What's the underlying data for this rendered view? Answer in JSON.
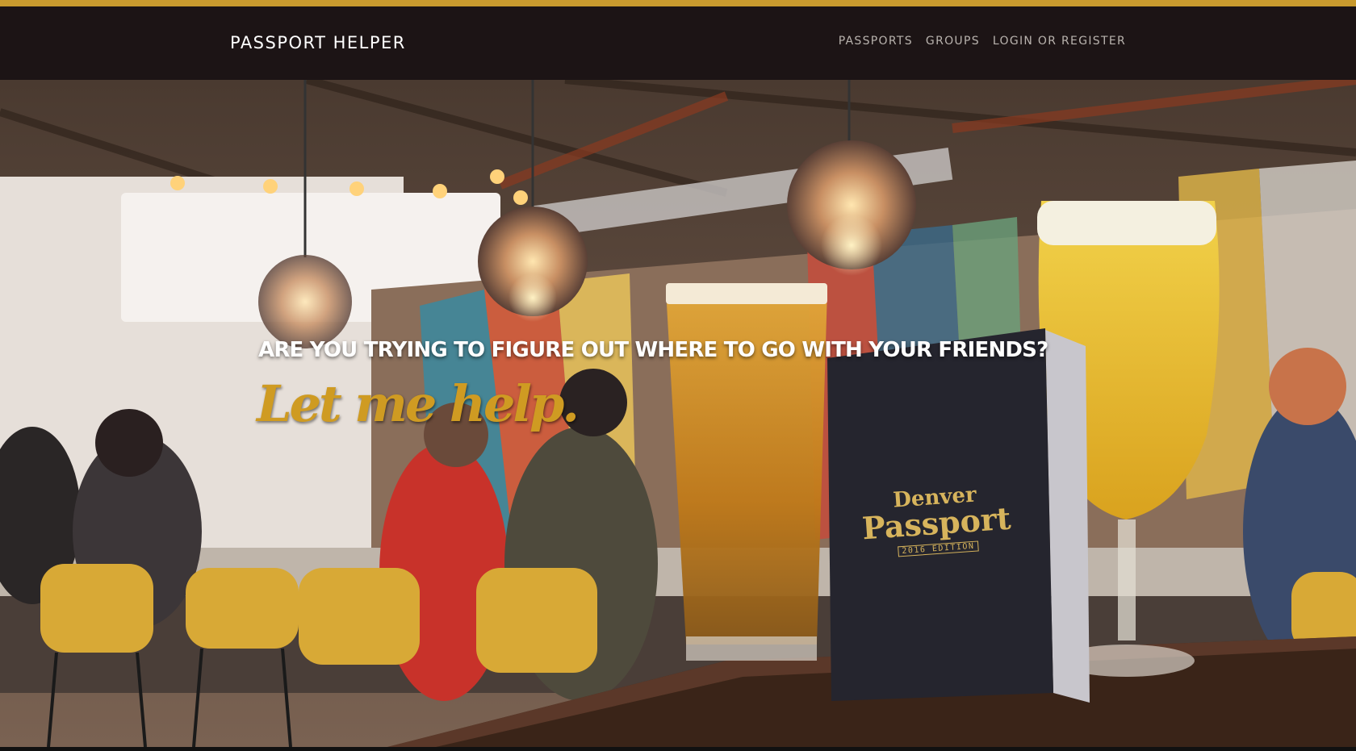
{
  "nav": {
    "brand": "PASSPORT HELPER",
    "links": [
      {
        "label": "PASSPORTS"
      },
      {
        "label": "GROUPS"
      },
      {
        "label": "LOGIN OR REGISTER"
      }
    ]
  },
  "hero": {
    "heading": "ARE YOU TRYING TO FIGURE OUT WHERE TO GO WITH YOUR FRIENDS?",
    "tagline": "Let me help.",
    "booklet": {
      "line1": "Denver",
      "line2": "Passport",
      "edition": "2016 EDITION"
    }
  },
  "colors": {
    "accent": "#c99a2e",
    "navbar": "#1c1415",
    "nav_text": "#b9b3ae",
    "heading": "#ffffff",
    "tagline": "#cf9b22"
  }
}
